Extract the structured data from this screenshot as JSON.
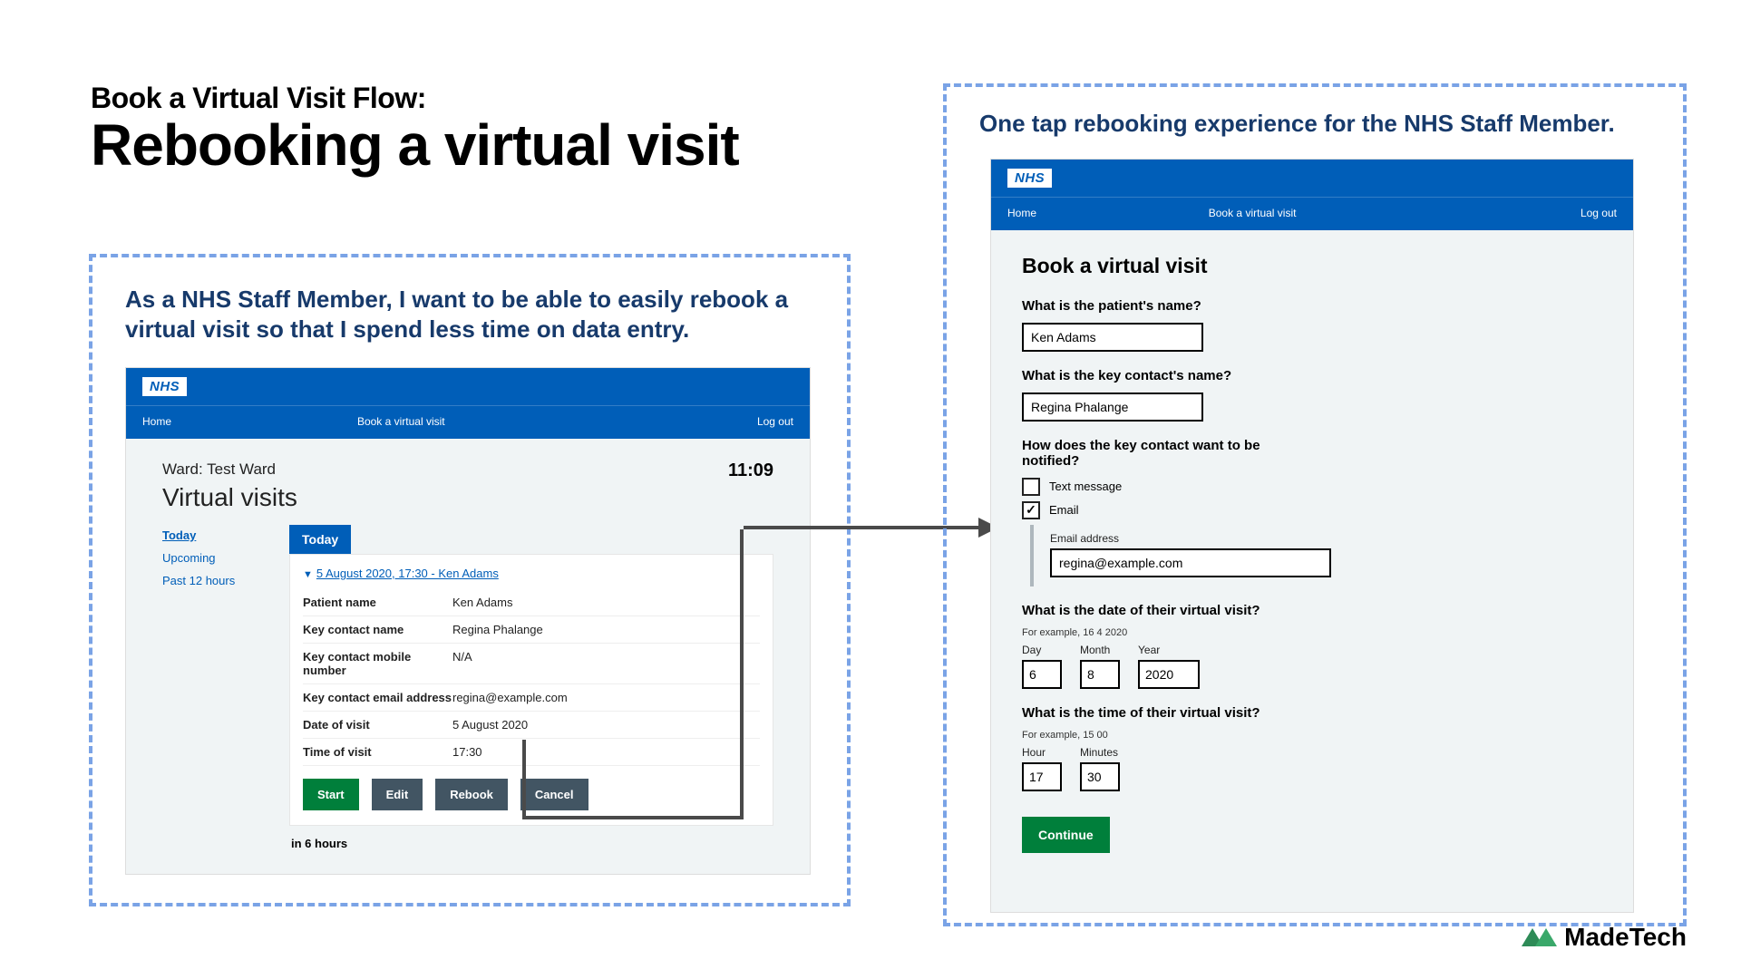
{
  "header": {
    "eyebrow": "Book a Virtual Visit Flow:",
    "title": "Rebooking a virtual visit"
  },
  "panel_left": {
    "title": "As a NHS Staff Member, I want to be able to easily rebook a virtual visit so that I spend less time on data entry.",
    "logo": "NHS",
    "nav": {
      "home": "Home",
      "book": "Book a virtual visit",
      "logout": "Log out"
    },
    "ward_label": "Ward: Test Ward",
    "clock": "11:09",
    "page_heading": "Virtual visits",
    "sidebar": {
      "today": "Today",
      "upcoming": "Upcoming",
      "past": "Past 12 hours"
    },
    "tab_label": "Today",
    "card_link": "5 August 2020, 17:30 - Ken Adams",
    "rows": {
      "patient_name": {
        "k": "Patient name",
        "v": "Ken Adams"
      },
      "contact_name": {
        "k": "Key contact name",
        "v": "Regina Phalange"
      },
      "contact_mobile": {
        "k": "Key contact mobile number",
        "v": "N/A"
      },
      "contact_email": {
        "k": "Key contact email address",
        "v": "regina@example.com"
      },
      "date": {
        "k": "Date of visit",
        "v": "5 August 2020"
      },
      "time": {
        "k": "Time of visit",
        "v": "17:30"
      }
    },
    "buttons": {
      "start": "Start",
      "edit": "Edit",
      "rebook": "Rebook",
      "cancel": "Cancel"
    },
    "footer_note": "in 6 hours"
  },
  "panel_right": {
    "title": "One tap rebooking experience for the NHS Staff Member.",
    "logo": "NHS",
    "nav": {
      "home": "Home",
      "book": "Book a virtual visit",
      "logout": "Log out"
    },
    "form_heading": "Book a virtual visit",
    "q_patient": "What is the patient's name?",
    "patient_value": "Ken Adams",
    "q_contact": "What is the key contact's name?",
    "contact_value": "Regina Phalange",
    "q_notify": "How does the key contact want to be notified?",
    "opt_text": "Text message",
    "opt_email": "Email",
    "email_label": "Email address",
    "email_value": "regina@example.com",
    "q_date": "What is the date of their virtual visit?",
    "date_hint": "For example, 16 4 2020",
    "date_labels": {
      "day": "Day",
      "month": "Month",
      "year": "Year"
    },
    "date_values": {
      "day": "6",
      "month": "8",
      "year": "2020"
    },
    "q_time": "What is the time of their virtual visit?",
    "time_hint": "For example, 15 00",
    "time_labels": {
      "hour": "Hour",
      "minutes": "Minutes"
    },
    "time_values": {
      "hour": "17",
      "minutes": "30"
    },
    "continue": "Continue"
  },
  "brand": "MadeTech"
}
